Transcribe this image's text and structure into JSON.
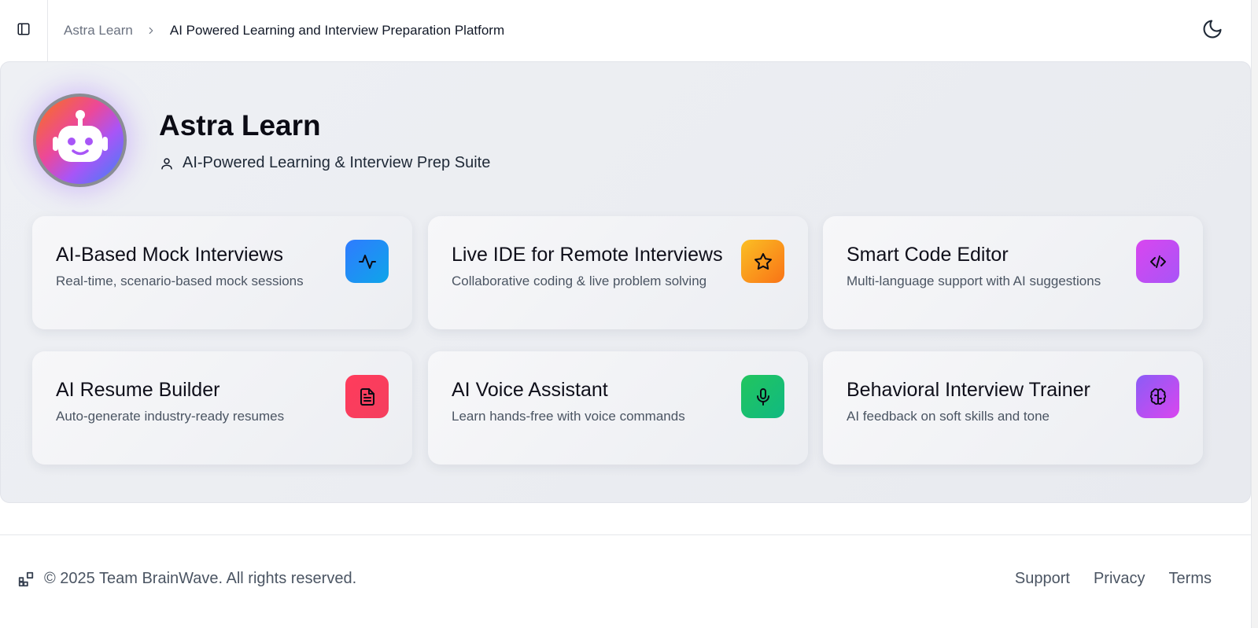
{
  "header": {
    "breadcrumb_root": "Astra Learn",
    "breadcrumb_current": "AI Powered Learning and Interview Preparation Platform"
  },
  "hero": {
    "title": "Astra Learn",
    "subtitle": "AI-Powered Learning & Interview Prep Suite"
  },
  "features": [
    {
      "title": "AI-Based Mock Interviews",
      "description": "Real-time, scenario-based mock sessions",
      "icon": "activity-icon",
      "color": "#1e90ff"
    },
    {
      "title": "Live IDE for Remote Interviews",
      "description": "Collaborative coding & live problem solving",
      "icon": "star-icon",
      "color": "#f59e0b"
    },
    {
      "title": "Smart Code Editor",
      "description": "Multi-language support with AI suggestions",
      "icon": "code-icon",
      "color": "#c026d3"
    },
    {
      "title": "AI Resume Builder",
      "description": "Auto-generate industry-ready resumes",
      "icon": "file-text-icon",
      "color": "#f43f5e"
    },
    {
      "title": "AI Voice Assistant",
      "description": "Learn hands-free with voice commands",
      "icon": "mic-icon",
      "color": "#16c060"
    },
    {
      "title": "Behavioral Interview Trainer",
      "description": "AI feedback on soft skills and tone",
      "icon": "brain-icon",
      "color": "#a855f7"
    }
  ],
  "footer": {
    "copyright": "© 2025 Team BrainWave. All rights reserved.",
    "links": [
      "Support",
      "Privacy",
      "Terms"
    ]
  }
}
